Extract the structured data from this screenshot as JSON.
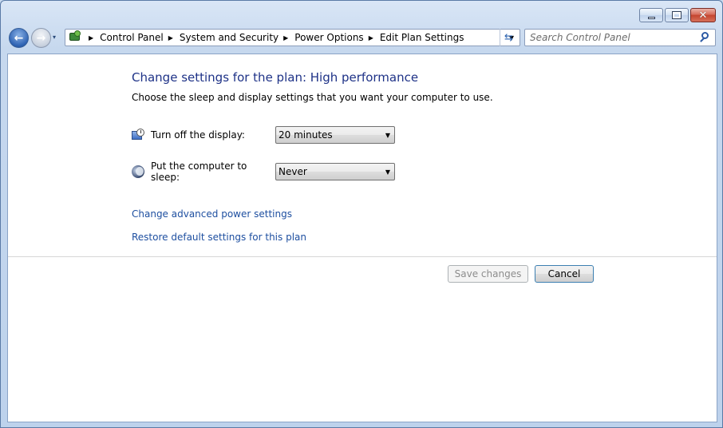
{
  "window": {
    "caption": {
      "minimize_glyph": "▁",
      "maximize_glyph": "□",
      "close_glyph": "✕"
    }
  },
  "navigation": {
    "back_glyph": "←",
    "forward_glyph": "→",
    "history_glyph": "▾",
    "breadcrumbs": [
      "Control Panel",
      "System and Security",
      "Power Options",
      "Edit Plan Settings"
    ],
    "breadcrumb_separator": "▶",
    "address_dropdown_glyph": "▼",
    "refresh_glyph": "⇆",
    "search_placeholder": "Search Control Panel"
  },
  "main": {
    "title": "Change settings for the plan: High performance",
    "subtitle": "Choose the sleep and display settings that you want your computer to use.",
    "settings": {
      "display": {
        "label": "Turn off the display:",
        "value": "20 minutes"
      },
      "sleep": {
        "label": "Put the computer to sleep:",
        "value": "Never"
      }
    },
    "combo_arrow": "▼",
    "links": {
      "advanced": "Change advanced power settings",
      "restore": "Restore default settings for this plan"
    },
    "buttons": {
      "save": "Save changes",
      "save_enabled": false,
      "cancel": "Cancel"
    }
  },
  "colors": {
    "heading": "#1e3287",
    "link": "#1e4fa0",
    "disabled_text": "#8d8d8d"
  }
}
